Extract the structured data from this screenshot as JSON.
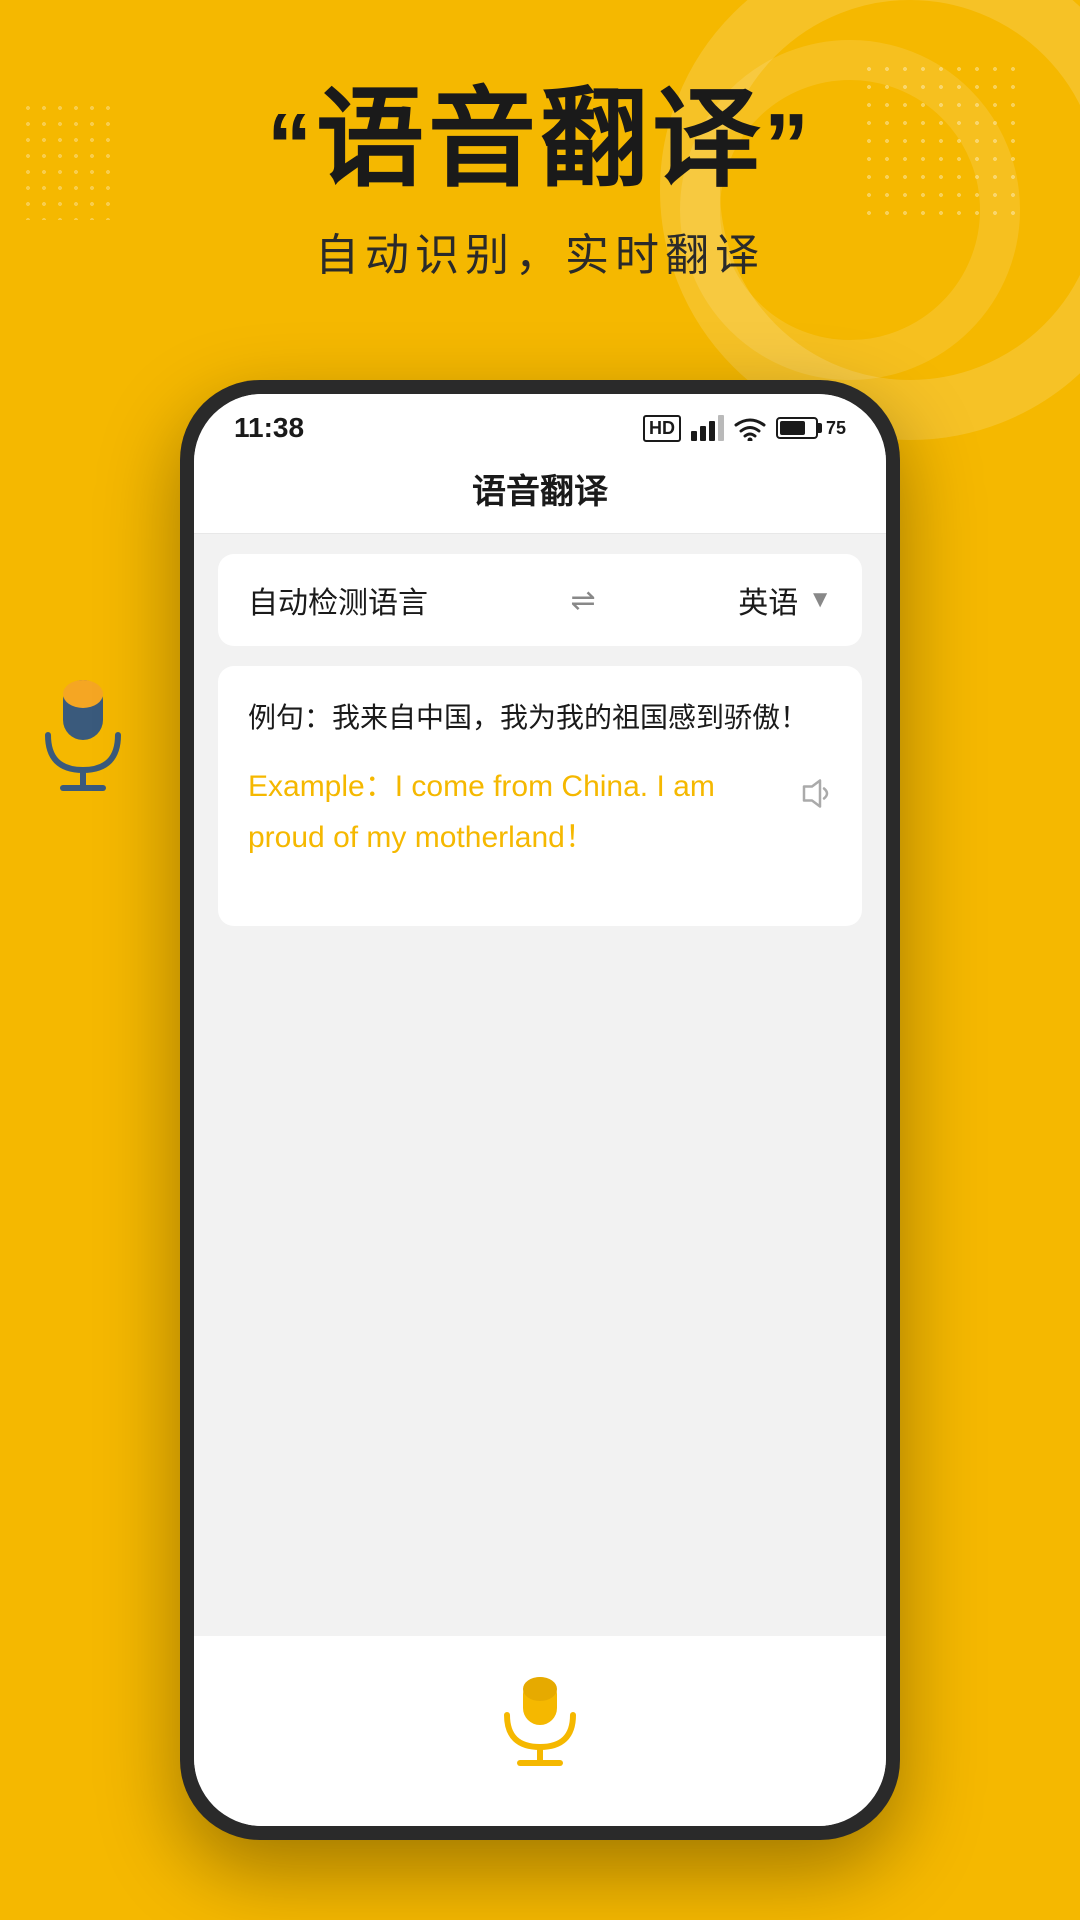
{
  "background": {
    "color": "#F5B800"
  },
  "header": {
    "quote_open": "“",
    "title": "语音翻译",
    "quote_close": "”",
    "subtitle": "自动识别，实时翻译"
  },
  "status_bar": {
    "time": "11:38",
    "hd_label": "HD",
    "battery_level": "75",
    "battery_percent": "75%"
  },
  "app": {
    "title": "语音翻译",
    "lang_source": "自动检测语言",
    "lang_swap": "⇌",
    "lang_target": "英语",
    "original_text": "例句：我来自中国，我为我的祖国感到骄傲！",
    "translated_text": "Example：I come from China. I am proud of my motherland！"
  }
}
